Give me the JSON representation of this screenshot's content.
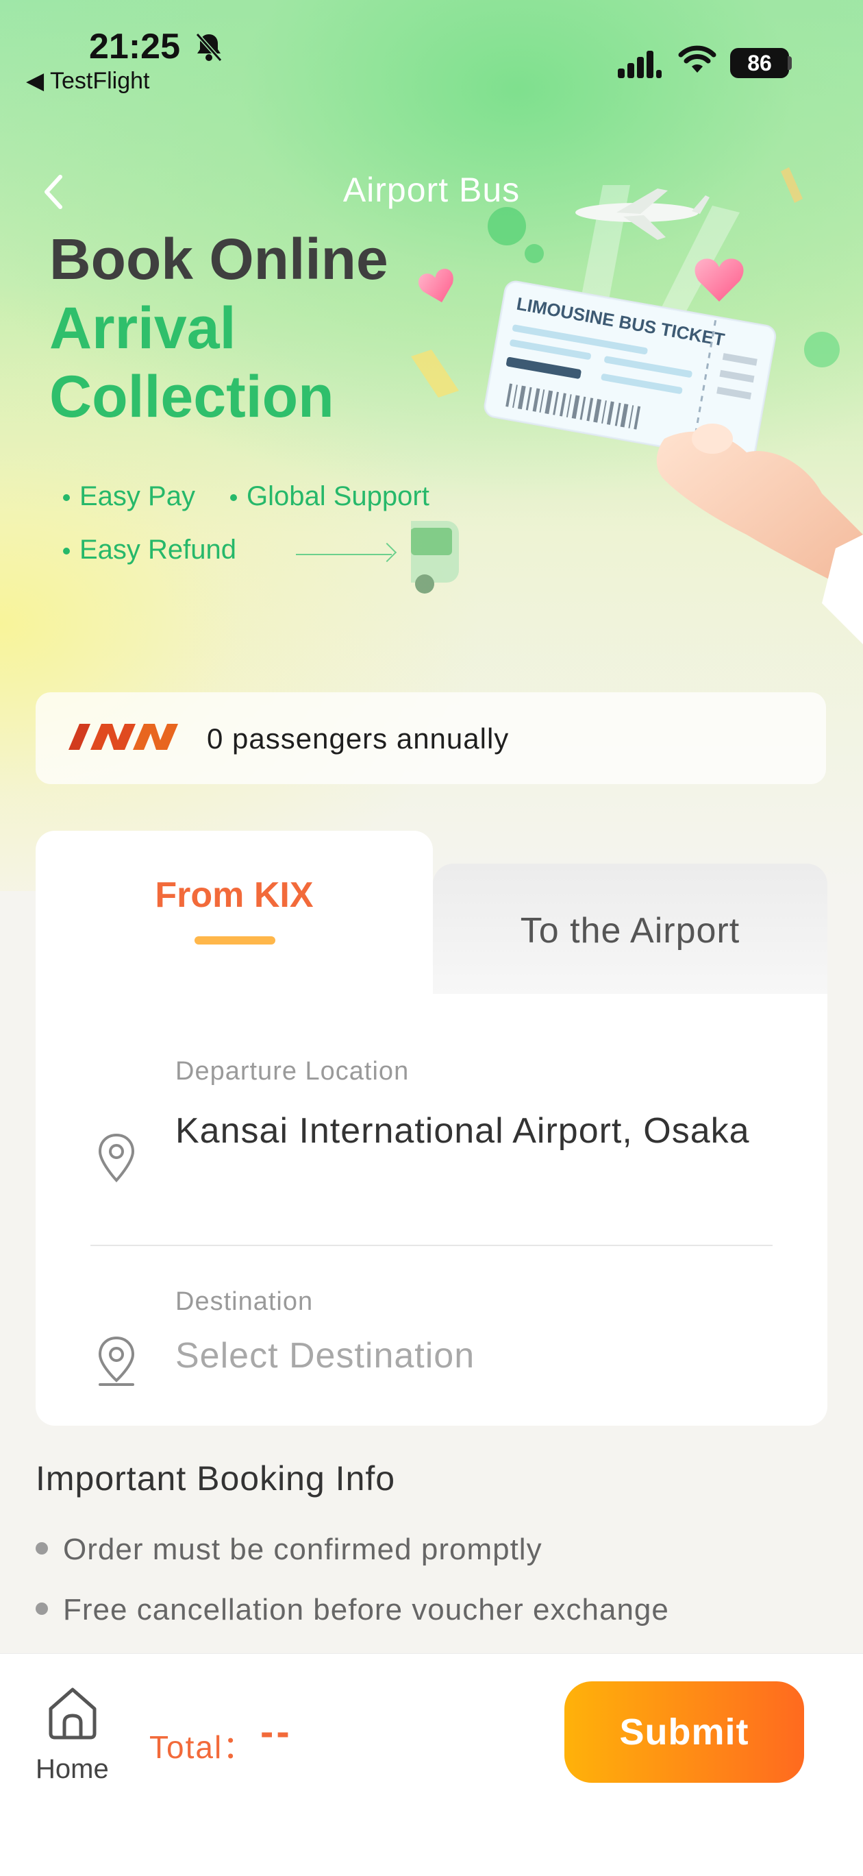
{
  "status_bar": {
    "time": "21:25",
    "back_app": "◀ TestFlight",
    "battery": "86"
  },
  "nav": {
    "title": "Airport Bus"
  },
  "hero": {
    "line1": "Book Online",
    "line2": "Arrival",
    "line3": "Collection",
    "features": [
      "Easy Pay",
      "Global Support",
      "Easy Refund"
    ],
    "ticket_text": "LIMOUSINE BUS TICKET"
  },
  "passengers": {
    "text": "0 passengers annually"
  },
  "tabs": [
    {
      "label": "From KIX",
      "active": true
    },
    {
      "label": "To the Airport",
      "active": false
    }
  ],
  "form": {
    "departure_label": "Departure Location",
    "departure_value": "Kansai International Airport, Osaka",
    "destination_label": "Destination",
    "destination_placeholder": "Select Destination"
  },
  "info": {
    "title": "Important Booking Info",
    "items": [
      "Order must be confirmed promptly",
      "Free cancellation before voucher exchange"
    ]
  },
  "bottom_bar": {
    "home_label": "Home",
    "total_label": "Total：",
    "total_value": "--",
    "submit_label": "Submit"
  },
  "colors": {
    "accent": "#f26a3a",
    "brand_green": "#2fbf6b",
    "submit_start": "#ffb20a",
    "submit_end": "#ff6a1f"
  }
}
